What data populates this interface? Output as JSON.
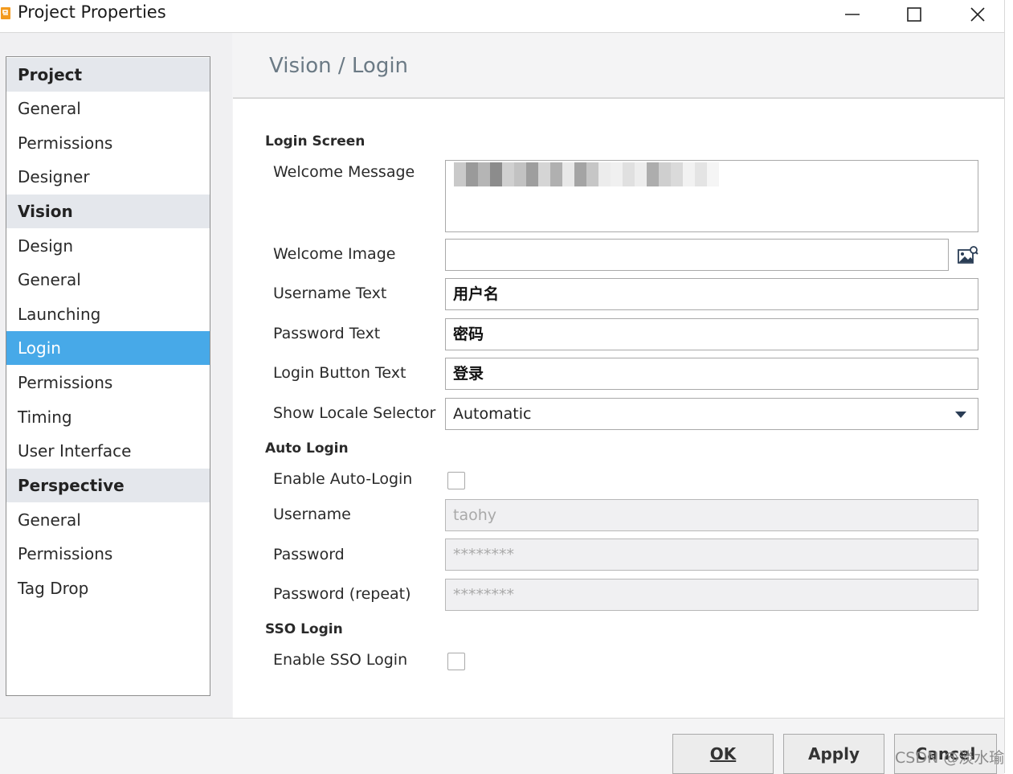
{
  "window": {
    "title": "Project Properties"
  },
  "sidebar": {
    "groups": [
      {
        "label": "Project",
        "items": [
          "General",
          "Permissions",
          "Designer"
        ]
      },
      {
        "label": "Vision",
        "items": [
          "Design",
          "General",
          "Launching",
          "Login",
          "Permissions",
          "Timing",
          "User Interface"
        ]
      },
      {
        "label": "Perspective",
        "items": [
          "General",
          "Permissions",
          "Tag Drop"
        ]
      }
    ],
    "selected": "Login"
  },
  "main": {
    "title": "Vision / Login",
    "login_screen": {
      "title": "Login Screen",
      "welcome_message_label": "Welcome Message",
      "welcome_image_label": "Welcome Image",
      "welcome_image_value": "",
      "username_text_label": "Username Text",
      "username_text_value": "用户名",
      "password_text_label": "Password Text",
      "password_text_value": "密码",
      "login_button_text_label": "Login Button Text",
      "login_button_text_value": "登录",
      "show_locale_selector_label": "Show Locale Selector",
      "show_locale_selector_value": "Automatic"
    },
    "auto_login": {
      "title": "Auto Login",
      "enable_label": "Enable Auto-Login",
      "enabled": false,
      "username_label": "Username",
      "username_value": "taohy",
      "password_label": "Password",
      "password_value": "********",
      "password_repeat_label": "Password (repeat)",
      "password_repeat_value": "********"
    },
    "sso_login": {
      "title": "SSO Login",
      "enable_label": "Enable SSO Login",
      "enabled": false
    }
  },
  "footer": {
    "ok_label": "OK",
    "apply_label": "Apply",
    "cancel_label": "Cancel"
  },
  "watermark": "CSDN @淡水瑜",
  "colors": {
    "selection": "#47a9e8",
    "group_header": "#e4e7ec",
    "title_text": "#6b7a85"
  }
}
